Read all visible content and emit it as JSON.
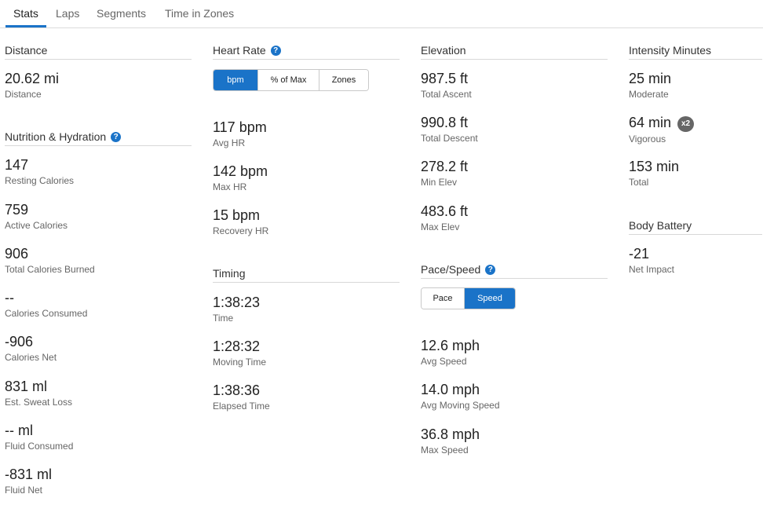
{
  "tabs": [
    "Stats",
    "Laps",
    "Segments",
    "Time in Zones"
  ],
  "help_glyph": "?",
  "distance": {
    "title": "Distance",
    "stats": [
      {
        "value": "20.62 mi",
        "label": "Distance"
      }
    ]
  },
  "nutrition": {
    "title": "Nutrition & Hydration",
    "stats": [
      {
        "value": "147",
        "label": "Resting Calories"
      },
      {
        "value": "759",
        "label": "Active Calories"
      },
      {
        "value": "906",
        "label": "Total Calories Burned"
      },
      {
        "value": "--",
        "label": "Calories Consumed"
      },
      {
        "value": "-906",
        "label": "Calories Net"
      },
      {
        "value": "831 ml",
        "label": "Est. Sweat Loss"
      },
      {
        "value": "-- ml",
        "label": "Fluid Consumed"
      },
      {
        "value": "-831 ml",
        "label": "Fluid Net"
      }
    ]
  },
  "heart_rate": {
    "title": "Heart Rate",
    "toggle": [
      "bpm",
      "% of Max",
      "Zones"
    ],
    "stats": [
      {
        "value": "117 bpm",
        "label": "Avg HR"
      },
      {
        "value": "142 bpm",
        "label": "Max HR"
      },
      {
        "value": "15 bpm",
        "label": "Recovery HR"
      }
    ]
  },
  "timing": {
    "title": "Timing",
    "stats": [
      {
        "value": "1:38:23",
        "label": "Time"
      },
      {
        "value": "1:28:32",
        "label": "Moving Time"
      },
      {
        "value": "1:38:36",
        "label": "Elapsed Time"
      }
    ]
  },
  "elevation": {
    "title": "Elevation",
    "stats": [
      {
        "value": "987.5 ft",
        "label": "Total Ascent"
      },
      {
        "value": "990.8 ft",
        "label": "Total Descent"
      },
      {
        "value": "278.2 ft",
        "label": "Min Elev"
      },
      {
        "value": "483.6 ft",
        "label": "Max Elev"
      }
    ]
  },
  "pace_speed": {
    "title": "Pace/Speed",
    "toggle": [
      "Pace",
      "Speed"
    ],
    "stats": [
      {
        "value": "12.6 mph",
        "label": "Avg Speed"
      },
      {
        "value": "14.0 mph",
        "label": "Avg Moving Speed"
      },
      {
        "value": "36.8 mph",
        "label": "Max Speed"
      }
    ]
  },
  "intensity": {
    "title": "Intensity Minutes",
    "stats": [
      {
        "value": "25 min",
        "label": "Moderate"
      },
      {
        "value": "64 min",
        "label": "Vigorous",
        "badge": "x2"
      },
      {
        "value": "153 min",
        "label": "Total"
      }
    ]
  },
  "body_battery": {
    "title": "Body Battery",
    "stats": [
      {
        "value": "-21",
        "label": "Net Impact"
      }
    ]
  }
}
